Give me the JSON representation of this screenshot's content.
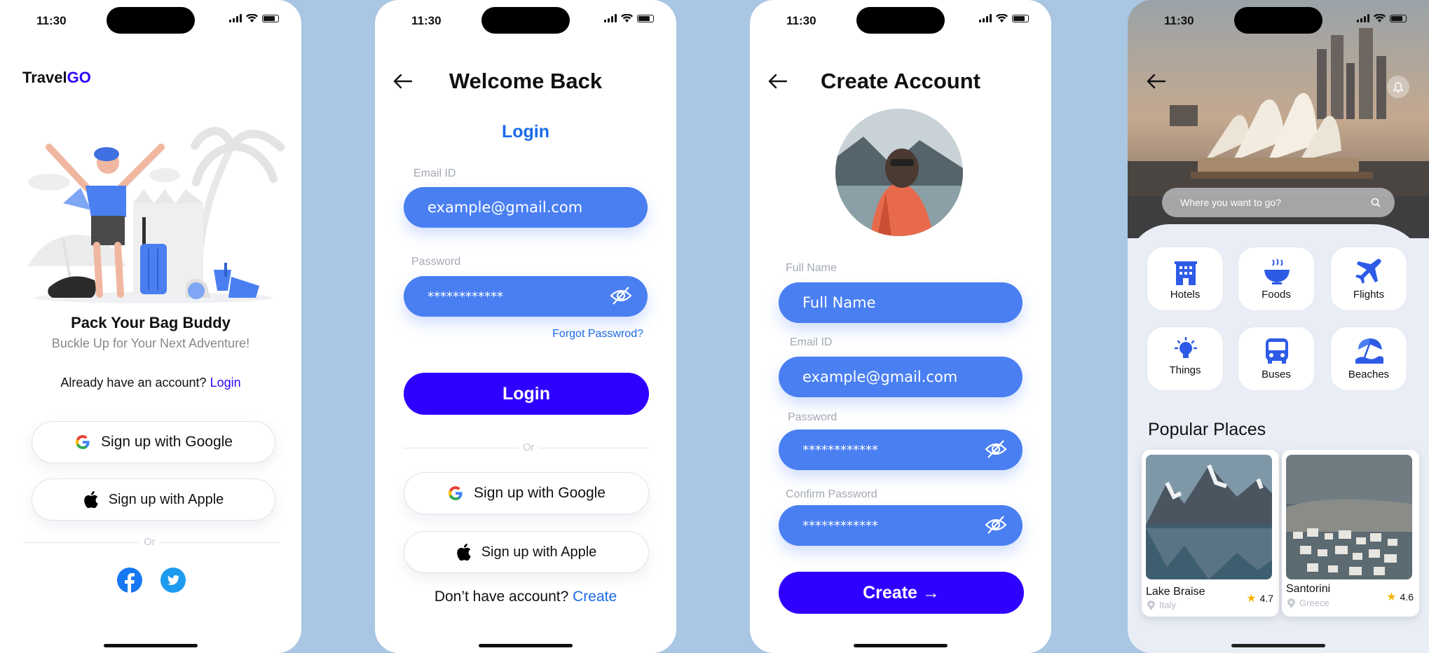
{
  "status": {
    "time": "11:30"
  },
  "screen1": {
    "brand_prefix": "Travel",
    "brand_suffix": "GO",
    "headline": "Pack Your Bag  Buddy",
    "subheadline": "Buckle Up for Your Next Adventure!",
    "account_prompt": "Already have an account?",
    "login_link": "Login",
    "google_button": "Sign up with Google",
    "apple_button": "Sign up with Apple",
    "or_label": "Or"
  },
  "screen2": {
    "title": "Welcome Back",
    "section_title": "Login",
    "email_label": "Email ID",
    "email_value": "example@gmail.com",
    "password_label": "Password",
    "password_value": "************",
    "forgot_link": "Forgot Passwrod?",
    "login_button": "Login",
    "or_label": "Or",
    "google_button": "Sign up with Google",
    "apple_button": "Sign up with Apple",
    "no_account_prompt": "Don’t have account?",
    "create_link": "Create"
  },
  "screen3": {
    "title": "Create Account",
    "fullname_label": "Full Name",
    "fullname_placeholder": "Full Name",
    "email_label": "Email ID",
    "email_value": "example@gmail.com",
    "password_label": "Password",
    "password_value": "************",
    "confirm_label": "Confirm Password",
    "confirm_value": "************",
    "create_button": "Create →"
  },
  "screen4": {
    "search_placeholder": "Where you want to go?",
    "categories": [
      {
        "label": "Hotels",
        "icon": "hotel-icon"
      },
      {
        "label": "Foods",
        "icon": "food-bowl-icon"
      },
      {
        "label": "Flights",
        "icon": "airplane-icon"
      },
      {
        "label": "Things",
        "icon": "lightbulb-icon"
      },
      {
        "label": "Buses",
        "icon": "bus-icon"
      },
      {
        "label": "Beaches",
        "icon": "beach-umbrella-icon"
      }
    ],
    "section_title": "Popular Places",
    "places": [
      {
        "name": "Lake Braise",
        "location": "Italy",
        "rating": "4.7"
      },
      {
        "name": "Santorini",
        "location": "Greece",
        "rating": "4.6"
      }
    ]
  },
  "colors": {
    "accent": "#2f00ff",
    "field_blue": "#4a7ff2",
    "link_blue": "#1a6be8",
    "background": "#a9c6e2"
  }
}
